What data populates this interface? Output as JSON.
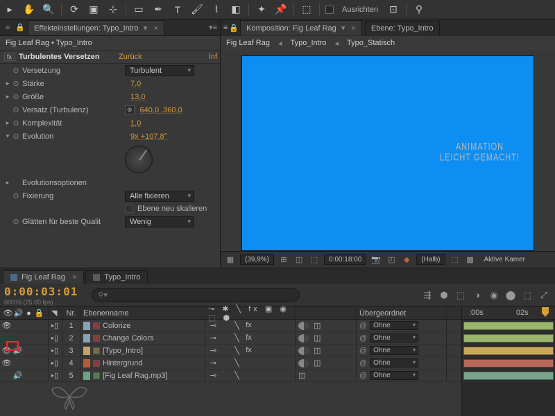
{
  "toolbar": {
    "align_label": "Ausrichten"
  },
  "effects_panel": {
    "tab_title": "Effekteinstellungen: Typo_Intro",
    "breadcrumb": "Fig Leaf Rag • Typo_Intro",
    "effect_name": "Turbulentes Versetzen",
    "reset_label": "Zurück",
    "info_label": "Inf",
    "props": {
      "versetzung": {
        "label": "Versetzung",
        "value": "Turbulent"
      },
      "staerke": {
        "label": "Stärke",
        "value": "7,0"
      },
      "groesse": {
        "label": "Größe",
        "value": "13,0"
      },
      "versatz": {
        "label": "Versatz (Turbulenz)",
        "value": "640,0 ,360,0"
      },
      "komplex": {
        "label": "Komplexität",
        "value": "1,0"
      },
      "evolution": {
        "label": "Evolution",
        "value": "9x +107,8°"
      },
      "evoopts": {
        "label": "Evolutionsoptionen"
      },
      "fixierung": {
        "label": "Fixierung",
        "value": "Alle fixieren"
      },
      "rescale": {
        "label": "Ebene neu skalieren"
      },
      "glaetten": {
        "label": "Glätten für beste Qualit",
        "value": "Wenig"
      }
    }
  },
  "comp_panel": {
    "tab_active": "Komposition: Fig Leaf Rag",
    "tab_inactive": "Ebene: Typo_Intro",
    "breadcrumb": [
      "Fig Leaf Rag",
      "Typo_Intro",
      "Typo_Statisch"
    ],
    "canvas_text_line1": "ANIMATION",
    "canvas_text_line2": "LEICHT GEMACHT!",
    "footer": {
      "zoom": "(39,9%)",
      "time": "0:00:18:00",
      "res": "(Halb)",
      "view": "Aktive Kamer"
    }
  },
  "timeline": {
    "tab_active": "Fig Leaf Rag",
    "tab_inactive": "Typo_Intro",
    "timecode": "0:00:03:01",
    "fps": "00076 (25.00 fps)",
    "search_placeholder": "",
    "col_nr": "Nr.",
    "col_name": "Ebenenname",
    "col_parent": "Übergeordnet",
    "ruler": {
      "t0": ":00s",
      "t1": "02s"
    },
    "layers": [
      {
        "n": "1",
        "name": "Colorize",
        "parent": "Ohne",
        "color": "#8aa2b8",
        "eye": true,
        "spk": false,
        "bar": "#9ab56c",
        "icon": "solid"
      },
      {
        "n": "2",
        "name": "Change Colors",
        "parent": "Ohne",
        "color": "#8aa2b8",
        "eye": false,
        "spk": false,
        "bar": "#9ab56c",
        "icon": "solid"
      },
      {
        "n": "3",
        "name": "[Typo_Intro]",
        "parent": "Ohne",
        "color": "#c2a46a",
        "eye": true,
        "spk": true,
        "bar": "#c9a85c",
        "icon": "comp"
      },
      {
        "n": "4",
        "name": "Hintergrund",
        "parent": "Ohne",
        "color": "#b85a3a",
        "eye": true,
        "spk": false,
        "bar": "#b86a5a",
        "icon": "solid"
      },
      {
        "n": "5",
        "name": "[Fig Leaf Rag.mp3]",
        "parent": "Ohne",
        "color": "#6aa28a",
        "eye": false,
        "spk": true,
        "bar": "#7aa58a",
        "icon": "audio"
      }
    ]
  }
}
